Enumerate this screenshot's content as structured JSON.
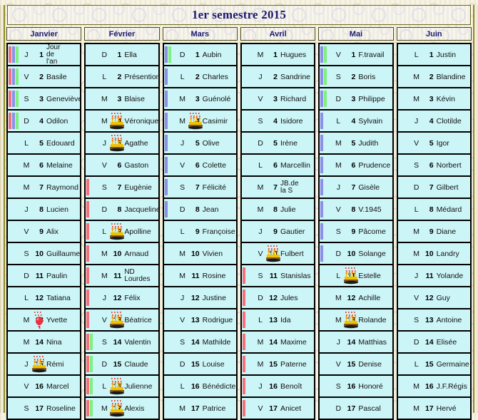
{
  "page": {
    "title": "1er semestre 2015",
    "accent_title_color": "#1b1b6e",
    "cell_bg_color": "#ccf5f7",
    "bar_colors": {
      "red": "#f4707a",
      "blue": "#8f8fe8",
      "green": "#7ef07e"
    }
  },
  "icons": {
    "cake": "birthday-cake-icon",
    "balloon": "balloon-icon"
  },
  "months": [
    {
      "name": "Janvier",
      "days": [
        {
          "dow": "J",
          "num": "1",
          "name": "Jour de l'an",
          "lines": [
            "Jour",
            "de",
            "l'an"
          ],
          "bars": [
            "red",
            "blue",
            "green"
          ],
          "icon": ""
        },
        {
          "dow": "V",
          "num": "2",
          "name": "Basile",
          "bars": [
            "red",
            "blue",
            "green"
          ],
          "icon": ""
        },
        {
          "dow": "S",
          "num": "3",
          "name": "Geneviève",
          "bars": [
            "red",
            "blue",
            "green"
          ],
          "icon": ""
        },
        {
          "dow": "D",
          "num": "4",
          "name": "Odilon",
          "bars": [
            "red",
            "blue",
            "green"
          ],
          "icon": ""
        },
        {
          "dow": "L",
          "num": "5",
          "name": "Edouard",
          "bars": [],
          "icon": ""
        },
        {
          "dow": "M",
          "num": "6",
          "name": "Melaine",
          "bars": [],
          "icon": ""
        },
        {
          "dow": "M",
          "num": "7",
          "name": "Raymond",
          "bars": [],
          "icon": ""
        },
        {
          "dow": "J",
          "num": "8",
          "name": "Lucien",
          "bars": [],
          "icon": ""
        },
        {
          "dow": "V",
          "num": "9",
          "name": "Alix",
          "bars": [],
          "icon": ""
        },
        {
          "dow": "S",
          "num": "10",
          "name": "Guillaume",
          "bars": [],
          "icon": ""
        },
        {
          "dow": "D",
          "num": "11",
          "name": "Paulin",
          "bars": [],
          "icon": ""
        },
        {
          "dow": "L",
          "num": "12",
          "name": "Tatiana",
          "bars": [],
          "icon": ""
        },
        {
          "dow": "M",
          "num": "13",
          "name": "Yvette",
          "bars": [],
          "icon": "balloon"
        },
        {
          "dow": "M",
          "num": "14",
          "name": "Nina",
          "bars": [],
          "icon": ""
        },
        {
          "dow": "J",
          "num": "15",
          "name": "Rémi",
          "bars": [],
          "icon": "cake"
        },
        {
          "dow": "V",
          "num": "16",
          "name": "Marcel",
          "bars": [],
          "icon": ""
        },
        {
          "dow": "S",
          "num": "17",
          "name": "Roseline",
          "bars": [],
          "icon": ""
        }
      ]
    },
    {
      "name": "Février",
      "days": [
        {
          "dow": "D",
          "num": "1",
          "name": "Ella",
          "bars": [],
          "icon": ""
        },
        {
          "dow": "L",
          "num": "2",
          "name": "Présention",
          "bars": [],
          "icon": ""
        },
        {
          "dow": "M",
          "num": "3",
          "name": "Blaise",
          "bars": [],
          "icon": ""
        },
        {
          "dow": "M",
          "num": "4",
          "name": "Véronique",
          "bars": [],
          "icon": "cake"
        },
        {
          "dow": "J",
          "num": "5",
          "name": "Agathe",
          "bars": [],
          "icon": "cake"
        },
        {
          "dow": "V",
          "num": "6",
          "name": "Gaston",
          "bars": [],
          "icon": ""
        },
        {
          "dow": "S",
          "num": "7",
          "name": "Eugènie",
          "bars": [
            "red"
          ],
          "icon": ""
        },
        {
          "dow": "D",
          "num": "8",
          "name": "Jacqueline",
          "bars": [
            "red"
          ],
          "icon": ""
        },
        {
          "dow": "L",
          "num": "9",
          "name": "Apolline",
          "bars": [
            "red"
          ],
          "icon": "cake"
        },
        {
          "dow": "M",
          "num": "10",
          "name": "Arnaud",
          "bars": [
            "red"
          ],
          "icon": ""
        },
        {
          "dow": "M",
          "num": "11",
          "name": "ND Lourdes",
          "lines": [
            "ND",
            "Lourdes"
          ],
          "bars": [
            "red"
          ],
          "icon": ""
        },
        {
          "dow": "J",
          "num": "12",
          "name": "Félix",
          "bars": [
            "red"
          ],
          "icon": ""
        },
        {
          "dow": "V",
          "num": "13",
          "name": "Béatrice",
          "bars": [
            "red"
          ],
          "icon": "cake"
        },
        {
          "dow": "S",
          "num": "14",
          "name": "Valentin",
          "bars": [
            "red",
            "green"
          ],
          "icon": ""
        },
        {
          "dow": "D",
          "num": "15",
          "name": "Claude",
          "bars": [
            "red",
            "green"
          ],
          "icon": ""
        },
        {
          "dow": "L",
          "num": "16",
          "name": "Julienne",
          "bars": [
            "red",
            "green"
          ],
          "icon": "cake"
        },
        {
          "dow": "M",
          "num": "17",
          "name": "Alexis",
          "bars": [
            "red",
            "green"
          ],
          "icon": "cake"
        }
      ]
    },
    {
      "name": "Mars",
      "days": [
        {
          "dow": "D",
          "num": "1",
          "name": "Aubin",
          "bars": [
            "blue",
            "green"
          ],
          "icon": ""
        },
        {
          "dow": "L",
          "num": "2",
          "name": "Charles",
          "bars": [
            "blue"
          ],
          "icon": ""
        },
        {
          "dow": "M",
          "num": "3",
          "name": "Guénolé",
          "bars": [
            "blue"
          ],
          "icon": ""
        },
        {
          "dow": "M",
          "num": "4",
          "name": "Casimir",
          "bars": [
            "blue"
          ],
          "icon": "cake"
        },
        {
          "dow": "J",
          "num": "5",
          "name": "Olive",
          "bars": [
            "blue"
          ],
          "icon": ""
        },
        {
          "dow": "V",
          "num": "6",
          "name": "Colette",
          "bars": [
            "blue"
          ],
          "icon": ""
        },
        {
          "dow": "S",
          "num": "7",
          "name": "Félicité",
          "bars": [
            "blue"
          ],
          "icon": ""
        },
        {
          "dow": "D",
          "num": "8",
          "name": "Jean",
          "bars": [
            "blue"
          ],
          "icon": ""
        },
        {
          "dow": "L",
          "num": "9",
          "name": "Françoise",
          "bars": [],
          "icon": ""
        },
        {
          "dow": "M",
          "num": "10",
          "name": "Vivien",
          "bars": [],
          "icon": ""
        },
        {
          "dow": "M",
          "num": "11",
          "name": "Rosine",
          "bars": [],
          "icon": ""
        },
        {
          "dow": "J",
          "num": "12",
          "name": "Justine",
          "bars": [],
          "icon": ""
        },
        {
          "dow": "V",
          "num": "13",
          "name": "Rodrigue",
          "bars": [],
          "icon": ""
        },
        {
          "dow": "S",
          "num": "14",
          "name": "Mathilde",
          "bars": [],
          "icon": ""
        },
        {
          "dow": "D",
          "num": "15",
          "name": "Louise",
          "bars": [],
          "icon": ""
        },
        {
          "dow": "L",
          "num": "16",
          "name": "Bénédicte",
          "bars": [],
          "icon": ""
        },
        {
          "dow": "M",
          "num": "17",
          "name": "Patrice",
          "bars": [],
          "icon": ""
        }
      ]
    },
    {
      "name": "Avril",
      "days": [
        {
          "dow": "M",
          "num": "1",
          "name": "Hugues",
          "bars": [],
          "icon": ""
        },
        {
          "dow": "J",
          "num": "2",
          "name": "Sandrine",
          "bars": [],
          "icon": ""
        },
        {
          "dow": "V",
          "num": "3",
          "name": "Richard",
          "bars": [],
          "icon": ""
        },
        {
          "dow": "S",
          "num": "4",
          "name": "Isidore",
          "bars": [],
          "icon": ""
        },
        {
          "dow": "D",
          "num": "5",
          "name": "Irène",
          "bars": [],
          "icon": ""
        },
        {
          "dow": "L",
          "num": "6",
          "name": "Marcellin",
          "bars": [],
          "icon": ""
        },
        {
          "dow": "M",
          "num": "7",
          "name": "JB.de la S",
          "lines": [
            "JB.de",
            "la S"
          ],
          "bars": [],
          "icon": ""
        },
        {
          "dow": "M",
          "num": "8",
          "name": "Julie",
          "bars": [],
          "icon": ""
        },
        {
          "dow": "J",
          "num": "9",
          "name": "Gautier",
          "bars": [],
          "icon": ""
        },
        {
          "dow": "V",
          "num": "10",
          "name": "Fulbert",
          "bars": [],
          "icon": "cake"
        },
        {
          "dow": "S",
          "num": "11",
          "name": "Stanislas",
          "bars": [
            "red"
          ],
          "icon": ""
        },
        {
          "dow": "D",
          "num": "12",
          "name": "Jules",
          "bars": [
            "red"
          ],
          "icon": ""
        },
        {
          "dow": "L",
          "num": "13",
          "name": "Ida",
          "bars": [
            "red"
          ],
          "icon": ""
        },
        {
          "dow": "M",
          "num": "14",
          "name": "Maxime",
          "bars": [
            "red"
          ],
          "icon": ""
        },
        {
          "dow": "M",
          "num": "15",
          "name": "Paterne",
          "bars": [
            "red"
          ],
          "icon": ""
        },
        {
          "dow": "J",
          "num": "16",
          "name": "Benoît",
          "bars": [
            "red"
          ],
          "icon": ""
        },
        {
          "dow": "V",
          "num": "17",
          "name": "Anicet",
          "bars": [
            "red"
          ],
          "icon": ""
        }
      ]
    },
    {
      "name": "Mai",
      "days": [
        {
          "dow": "V",
          "num": "1",
          "name": "F.travail",
          "bars": [
            "blue",
            "green"
          ],
          "icon": ""
        },
        {
          "dow": "S",
          "num": "2",
          "name": "Boris",
          "bars": [
            "blue",
            "green"
          ],
          "icon": ""
        },
        {
          "dow": "D",
          "num": "3",
          "name": "Philippe",
          "bars": [
            "blue",
            "green"
          ],
          "icon": ""
        },
        {
          "dow": "L",
          "num": "4",
          "name": "Sylvain",
          "bars": [
            "blue"
          ],
          "icon": ""
        },
        {
          "dow": "M",
          "num": "5",
          "name": "Judith",
          "bars": [
            "blue"
          ],
          "icon": ""
        },
        {
          "dow": "M",
          "num": "6",
          "name": "Prudence",
          "bars": [
            "blue"
          ],
          "icon": ""
        },
        {
          "dow": "J",
          "num": "7",
          "name": "Gisèle",
          "bars": [
            "blue"
          ],
          "icon": ""
        },
        {
          "dow": "V",
          "num": "8",
          "name": "V.1945",
          "bars": [
            "blue"
          ],
          "icon": ""
        },
        {
          "dow": "S",
          "num": "9",
          "name": "Pâcome",
          "bars": [
            "blue"
          ],
          "icon": ""
        },
        {
          "dow": "D",
          "num": "10",
          "name": "Solange",
          "bars": [
            "blue"
          ],
          "icon": ""
        },
        {
          "dow": "L",
          "num": "11",
          "name": "Estelle",
          "bars": [],
          "icon": "cake"
        },
        {
          "dow": "M",
          "num": "12",
          "name": "Achille",
          "bars": [],
          "icon": ""
        },
        {
          "dow": "M",
          "num": "13",
          "name": "Rolande",
          "bars": [],
          "icon": "cake"
        },
        {
          "dow": "J",
          "num": "14",
          "name": "Matthias",
          "bars": [],
          "icon": ""
        },
        {
          "dow": "V",
          "num": "15",
          "name": "Denise",
          "bars": [],
          "icon": ""
        },
        {
          "dow": "S",
          "num": "16",
          "name": "Honoré",
          "bars": [],
          "icon": ""
        },
        {
          "dow": "D",
          "num": "17",
          "name": "Pascal",
          "bars": [],
          "icon": ""
        }
      ]
    },
    {
      "name": "Juin",
      "days": [
        {
          "dow": "L",
          "num": "1",
          "name": "Justin",
          "bars": [],
          "icon": ""
        },
        {
          "dow": "M",
          "num": "2",
          "name": "Blandine",
          "bars": [],
          "icon": ""
        },
        {
          "dow": "M",
          "num": "3",
          "name": "Kévin",
          "bars": [],
          "icon": ""
        },
        {
          "dow": "J",
          "num": "4",
          "name": "Clotilde",
          "bars": [],
          "icon": ""
        },
        {
          "dow": "V",
          "num": "5",
          "name": "Igor",
          "bars": [],
          "icon": ""
        },
        {
          "dow": "S",
          "num": "6",
          "name": "Norbert",
          "bars": [],
          "icon": ""
        },
        {
          "dow": "D",
          "num": "7",
          "name": "Gilbert",
          "bars": [],
          "icon": ""
        },
        {
          "dow": "L",
          "num": "8",
          "name": "Médard",
          "bars": [],
          "icon": ""
        },
        {
          "dow": "M",
          "num": "9",
          "name": "Diane",
          "bars": [],
          "icon": ""
        },
        {
          "dow": "M",
          "num": "10",
          "name": "Landry",
          "bars": [],
          "icon": ""
        },
        {
          "dow": "J",
          "num": "11",
          "name": "Yolande",
          "bars": [],
          "icon": ""
        },
        {
          "dow": "V",
          "num": "12",
          "name": "Guy",
          "bars": [],
          "icon": ""
        },
        {
          "dow": "S",
          "num": "13",
          "name": "Antoine",
          "bars": [],
          "icon": ""
        },
        {
          "dow": "D",
          "num": "14",
          "name": "Elisée",
          "bars": [],
          "icon": ""
        },
        {
          "dow": "L",
          "num": "15",
          "name": "Germaine",
          "bars": [],
          "icon": ""
        },
        {
          "dow": "M",
          "num": "16",
          "name": "J.F.Régis",
          "bars": [],
          "icon": ""
        },
        {
          "dow": "M",
          "num": "17",
          "name": "Hervé",
          "bars": [],
          "icon": ""
        }
      ]
    }
  ]
}
